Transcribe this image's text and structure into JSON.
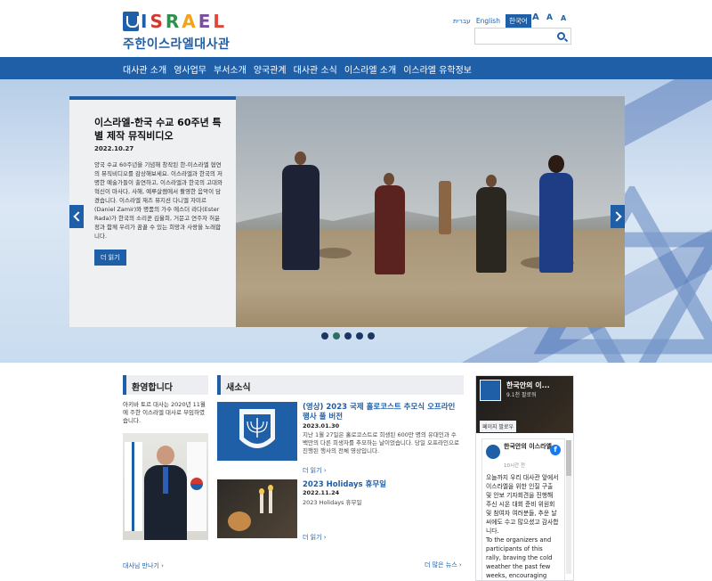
{
  "header": {
    "logo_letters": [
      "I",
      "S",
      "R",
      "A",
      "E",
      "L"
    ],
    "logo_colors": [
      "#1f5fa8",
      "#d2382e",
      "#2f8f4e",
      "#f2a31b",
      "#7b4fa0",
      "#e2463a"
    ],
    "site_name": "주한이스라엘대사관",
    "languages": [
      "עברית",
      "English",
      "한국어"
    ],
    "active_language": "한국어",
    "font_sizes": [
      "A",
      "A",
      "A"
    ],
    "search_placeholder": ""
  },
  "nav": {
    "items": [
      "대사관 소개",
      "영사업무",
      "부서소개",
      "양국관계",
      "대사관 소식",
      "이스라엘 소개",
      "이스라엘 유학정보"
    ]
  },
  "hero": {
    "title": "이스라엘-한국 수교 60주년 특별 제작 뮤직비디오",
    "date": "2022.10.27",
    "body": "양국 수교 60주년을 기념해 창작된 한-이스라엘 협연의 뮤직비디오를 감상해보세요. 이스라엘과 한국의 저명한 예술가들이 출연하고, 이스라엘과 한국의 고대와 혁신이 마사다, 사해, 예루살렘에서 촬영한 음악이 담겼습니다. 이스라엘 재즈 뮤지션 다니엘 자미르(Daniel Zamir)와 명품의 가수 에스더 라다(Ester Rada)가 한국의 소리꾼 김율희, 거문고 연주자 허윤정과 함께 우리가 꿈꿀 수 있는 희망과 사랑을 노래합니다.",
    "button": "더 읽기",
    "slide_count": 5,
    "active_slide": 1
  },
  "welcome": {
    "title": "환영합니다",
    "text": "아키바 토르 대사는 2020년 11월에 주한 이스라엘 대사로 부임하였습니다.",
    "link": "대사님 만나기"
  },
  "news": {
    "title": "새소식",
    "items": [
      {
        "title": "(영상) 2023 국제 홀로코스트 추모식 오프라인 행사 풀 버전",
        "date": "2023.01.30",
        "body": "지난 1월 27일은 홀로코스트로 희생된 600만 명의 유대인과 수 백만의 다른 희생자를 추모하는 날이었습니다. 당일 오프라인으로 진행된 행사의 전체 영상입니다.",
        "link": "더 읽기"
      },
      {
        "title": "2023 Holidays 휴무일",
        "date": "2022.11.24",
        "body": "2023 Holidays 휴무일",
        "link": "더 읽기"
      }
    ],
    "more_link": "더 많은 뉴스"
  },
  "facebook": {
    "page_name": "한국안의 이...",
    "followers": "9.1천 팔로워",
    "like_button": "페이지 팔로우",
    "post_author": "한국안의 이스라엘",
    "post_time": "10시간 전",
    "post_text_ko": "오늘까지 우리 대사관 앞에서 이스라엘을 위한 인질 구출 및 안보 기자회견을 진행해 주신 시온 대회 준비 위원회 및 참여자 여러분들, 추운 날씨에도 수고 많으셨고 감사합니다.",
    "post_text_en": "To the organizers and participants of this rally, braving the cold weather the past few weeks, encouraging people to learn about Israel's"
  }
}
